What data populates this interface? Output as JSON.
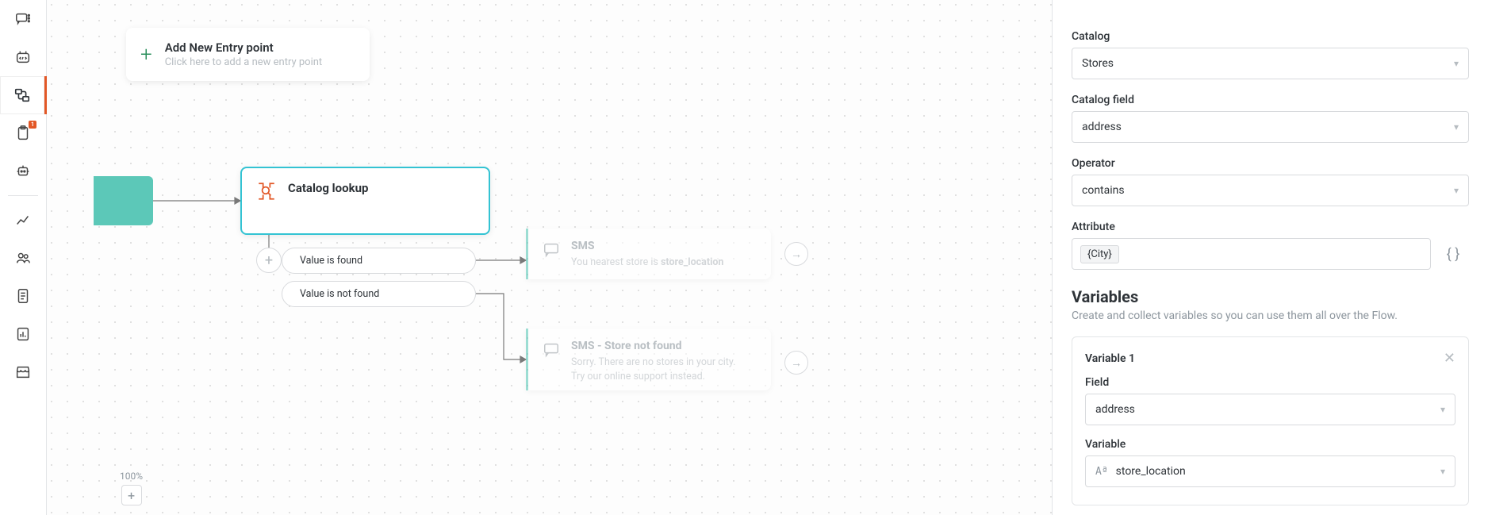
{
  "sidenav": {
    "badge": "1",
    "items": [
      {
        "name": "messages-icon"
      },
      {
        "name": "code-block-icon"
      },
      {
        "name": "flow-icon",
        "active": true
      },
      {
        "name": "clipboard-icon",
        "badge": true
      },
      {
        "name": "bot-icon"
      },
      {
        "name": "sep"
      },
      {
        "name": "analytics-icon"
      },
      {
        "name": "people-icon"
      },
      {
        "name": "doc-icon"
      },
      {
        "name": "report-icon"
      },
      {
        "name": "storefront-icon"
      }
    ]
  },
  "canvas": {
    "entry": {
      "title": "Add New Entry point",
      "subtitle": "Click here to add a new entry point"
    },
    "catalog_node": {
      "title": "Catalog lookup"
    },
    "decisions": {
      "found": "Value is found",
      "not_found": "Value is not found"
    },
    "sms1": {
      "title": "SMS",
      "body_prefix": "You nearest store is ",
      "body_var": "store_location"
    },
    "sms2": {
      "title": "SMS - Store not found",
      "body_line1": "Sorry. There are no stores in your city.",
      "body_line2": "Try our online support instead."
    },
    "zoom": {
      "label": "100%",
      "plus": "+"
    }
  },
  "panel": {
    "catalog": {
      "label": "Catalog",
      "value": "Stores"
    },
    "catalog_field": {
      "label": "Catalog field",
      "value": "address"
    },
    "operator": {
      "label": "Operator",
      "value": "contains"
    },
    "attribute": {
      "label": "Attribute",
      "chip": "{City}"
    },
    "variables": {
      "title": "Variables",
      "subtitle": "Create and collect variables so you can use them all over the Flow."
    },
    "variable1": {
      "title": "Variable 1",
      "field_label": "Field",
      "field_value": "address",
      "var_label": "Variable",
      "var_value": "store_location",
      "var_icon": "Aª"
    }
  }
}
